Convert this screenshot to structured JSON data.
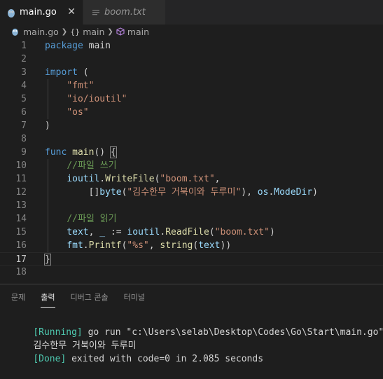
{
  "tabs": [
    {
      "label": "main.go",
      "icon": "gopher-icon",
      "close": "✕"
    },
    {
      "label": "boom.txt",
      "icon": "text-file-icon"
    }
  ],
  "breadcrumb": {
    "file": "main.go",
    "package": "main",
    "function": "main",
    "braces": "{}"
  },
  "code_lines": [
    {
      "n": "1",
      "tokens": [
        [
          "kw",
          "package"
        ],
        [
          "pl",
          " "
        ],
        [
          "pl",
          "main"
        ]
      ]
    },
    {
      "n": "2",
      "tokens": []
    },
    {
      "n": "3",
      "tokens": [
        [
          "kw",
          "import"
        ],
        [
          "pl",
          " ("
        ]
      ]
    },
    {
      "n": "4",
      "tokens": [
        [
          "pl",
          "    "
        ],
        [
          "str",
          "\"fmt\""
        ]
      ]
    },
    {
      "n": "5",
      "tokens": [
        [
          "pl",
          "    "
        ],
        [
          "str",
          "\"io/ioutil\""
        ]
      ]
    },
    {
      "n": "6",
      "tokens": [
        [
          "pl",
          "    "
        ],
        [
          "str",
          "\"os\""
        ]
      ]
    },
    {
      "n": "7",
      "tokens": [
        [
          "pl",
          ")"
        ]
      ]
    },
    {
      "n": "8",
      "tokens": []
    },
    {
      "n": "9",
      "tokens": [
        [
          "kw",
          "func"
        ],
        [
          "pl",
          " "
        ],
        [
          "fn",
          "main"
        ],
        [
          "pl",
          "() "
        ],
        [
          "brace",
          "{"
        ]
      ]
    },
    {
      "n": "10",
      "tokens": [
        [
          "pl",
          "    "
        ],
        [
          "cm",
          "//파일 쓰기"
        ]
      ]
    },
    {
      "n": "11",
      "tokens": [
        [
          "pl",
          "    "
        ],
        [
          "id",
          "ioutil"
        ],
        [
          "pl",
          "."
        ],
        [
          "fn",
          "WriteFile"
        ],
        [
          "pl",
          "("
        ],
        [
          "str",
          "\"boom.txt\""
        ],
        [
          "pl",
          ","
        ]
      ]
    },
    {
      "n": "12",
      "tokens": [
        [
          "pl",
          "        "
        ],
        [
          "pl",
          "[]"
        ],
        [
          "id",
          "byte"
        ],
        [
          "pl",
          "("
        ],
        [
          "str",
          "\"김수한무 거북이와 두루미\""
        ],
        [
          "pl",
          "), "
        ],
        [
          "id",
          "os"
        ],
        [
          "pl",
          "."
        ],
        [
          "id",
          "ModeDir"
        ],
        [
          "pl",
          ")"
        ]
      ]
    },
    {
      "n": "13",
      "tokens": []
    },
    {
      "n": "14",
      "tokens": [
        [
          "pl",
          "    "
        ],
        [
          "cm",
          "//파일 읽기"
        ]
      ]
    },
    {
      "n": "15",
      "tokens": [
        [
          "pl",
          "    "
        ],
        [
          "id",
          "text"
        ],
        [
          "pl",
          ", "
        ],
        [
          "id",
          "_"
        ],
        [
          "pl",
          " := "
        ],
        [
          "id",
          "ioutil"
        ],
        [
          "pl",
          "."
        ],
        [
          "fn",
          "ReadFile"
        ],
        [
          "pl",
          "("
        ],
        [
          "str",
          "\"boom.txt\""
        ],
        [
          "pl",
          ")"
        ]
      ]
    },
    {
      "n": "16",
      "tokens": [
        [
          "pl",
          "    "
        ],
        [
          "id",
          "fmt"
        ],
        [
          "pl",
          "."
        ],
        [
          "fn",
          "Printf"
        ],
        [
          "pl",
          "("
        ],
        [
          "str",
          "\"%s\""
        ],
        [
          "pl",
          ", "
        ],
        [
          "fn",
          "string"
        ],
        [
          "pl",
          "("
        ],
        [
          "id",
          "text"
        ],
        [
          "pl",
          "))"
        ]
      ]
    },
    {
      "n": "17",
      "tokens": [
        [
          "brace",
          "}"
        ]
      ]
    },
    {
      "n": "18",
      "tokens": []
    }
  ],
  "current_line": "17",
  "panel": {
    "tabs": [
      "문제",
      "출력",
      "디버그 콘솔",
      "터미널"
    ],
    "active_tab": "출력",
    "output": [
      {
        "prefix": "[Running]",
        "text": " go run \"c:\\Users\\selab\\Desktop\\Codes\\Go\\Start\\main.go\""
      },
      {
        "prefix": "",
        "text": "김수한무 거북이와 두루미"
      },
      {
        "prefix": "[Done]",
        "text": " exited with code=0 in 2.085 seconds"
      }
    ]
  },
  "colors": {
    "background": "#1e1e1e",
    "keyword": "#569cd6",
    "string": "#ce9178",
    "comment": "#6a9955",
    "function": "#dcdcaa"
  }
}
